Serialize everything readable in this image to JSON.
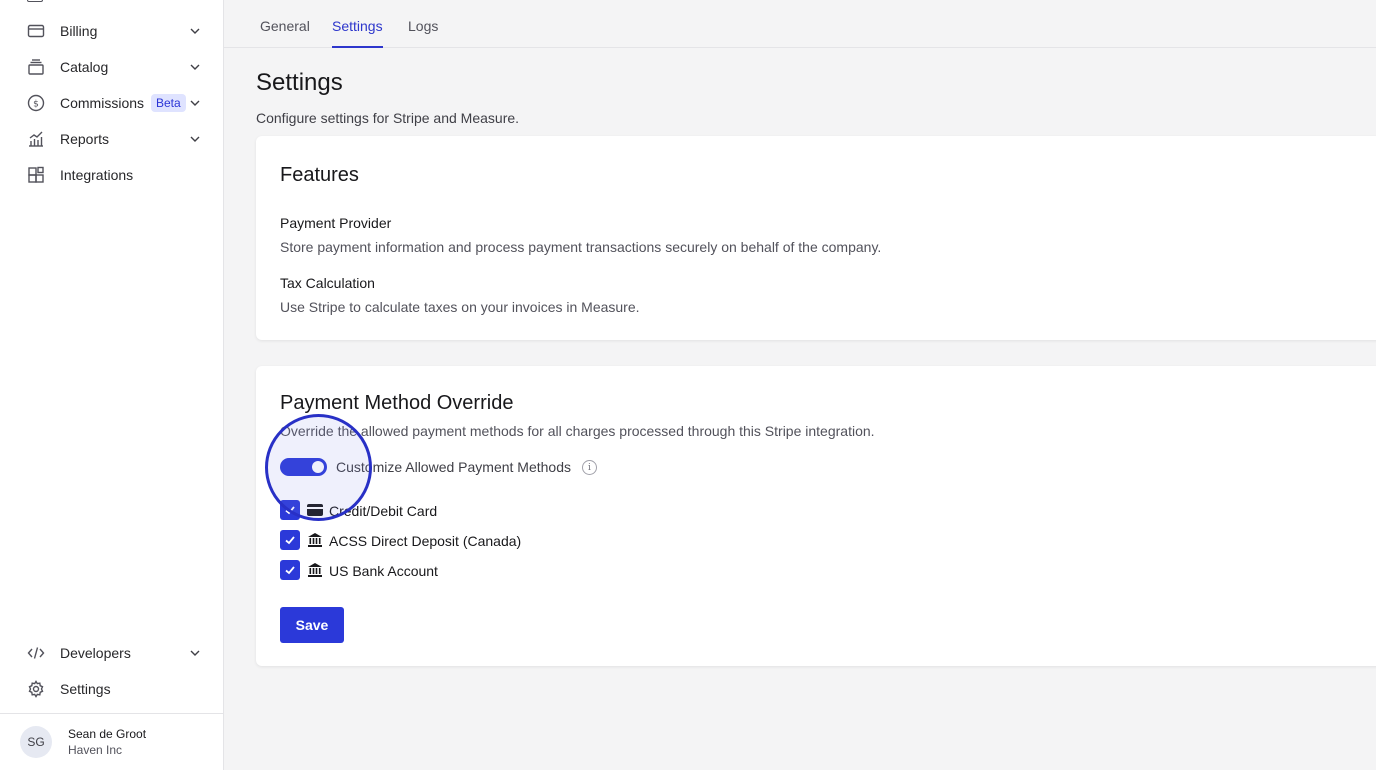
{
  "sidebar": {
    "items": [
      {
        "label": "Billing",
        "icon": "credit-card-icon"
      },
      {
        "label": "Catalog",
        "icon": "catalog-icon"
      },
      {
        "label": "Commissions",
        "icon": "dollar-circle-icon",
        "badge": "Beta"
      },
      {
        "label": "Reports",
        "icon": "chart-icon"
      },
      {
        "label": "Integrations",
        "icon": "integrations-icon"
      }
    ],
    "bottom_items": [
      {
        "label": "Developers",
        "icon": "code-icon"
      },
      {
        "label": "Settings",
        "icon": "gear-icon"
      }
    ],
    "user": {
      "initials": "SG",
      "name": "Sean de Groot",
      "org": "Haven Inc"
    }
  },
  "tabs": [
    {
      "label": "General",
      "active": false
    },
    {
      "label": "Settings",
      "active": true
    },
    {
      "label": "Logs",
      "active": false
    }
  ],
  "page": {
    "title": "Settings",
    "subtitle": "Configure settings for Stripe and Measure."
  },
  "features": {
    "title": "Features",
    "items": [
      {
        "title": "Payment Provider",
        "description": "Store payment information and process payment transactions securely on behalf of the company."
      },
      {
        "title": "Tax Calculation",
        "description": "Use Stripe to calculate taxes on your invoices in Measure."
      }
    ]
  },
  "override": {
    "title": "Payment Method Override",
    "description": "Override the allowed payment methods for all charges processed through this Stripe integration.",
    "toggle_label": "Customize Allowed Payment Methods",
    "toggle_on": true,
    "info_glyph": "i",
    "methods": [
      {
        "label": "Credit/Debit Card",
        "icon": "card-icon",
        "checked": true
      },
      {
        "label": "ACSS Direct Deposit (Canada)",
        "icon": "bank-icon",
        "checked": true
      },
      {
        "label": "US Bank Account",
        "icon": "bank-icon",
        "checked": true
      }
    ],
    "save_label": "Save"
  },
  "colors": {
    "accent": "#2b39d9",
    "highlight_ring": "#2830c6"
  }
}
